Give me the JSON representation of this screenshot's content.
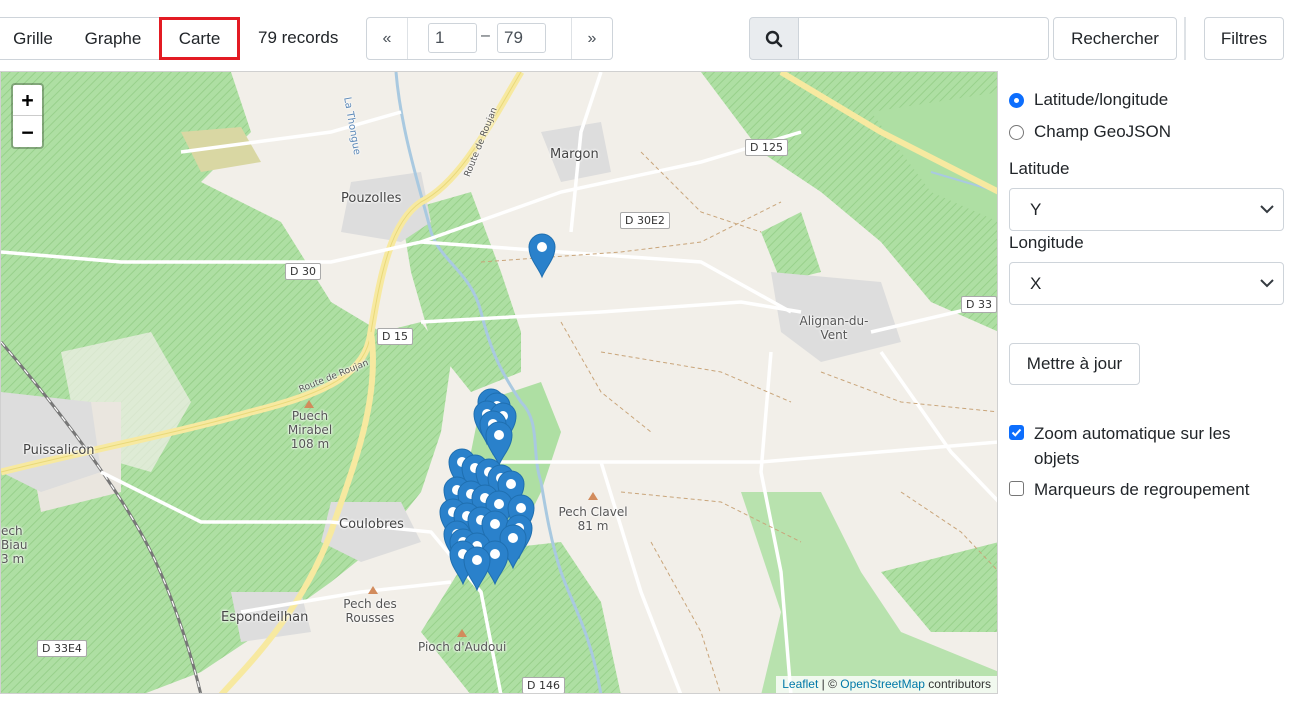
{
  "toolbar": {
    "view_tabs": [
      "Grille",
      "Graphe",
      "Carte"
    ],
    "active_tab": "Carte",
    "records_label": "79 records",
    "pager": {
      "prev": "«",
      "start": "1",
      "separator": "–",
      "end": "79",
      "next": "»"
    },
    "search_value": "",
    "search_button": "Rechercher",
    "filters_button": "Filtres"
  },
  "map": {
    "zoom_in": "+",
    "zoom_out": "−",
    "places": {
      "margon": "Margon",
      "pouzolles": "Pouzolles",
      "alignan_1": "Alignan-du-",
      "alignan_2": "Vent",
      "puissalicon": "Puissalicon",
      "coulobres": "Coulobres",
      "espondeilhan": "Espondeilhan",
      "puech_mirabel_1": "Puech",
      "puech_mirabel_2": "Mirabel",
      "puech_mirabel_3": "108 m",
      "pech_clavel_1": "Pech Clavel",
      "pech_clavel_2": "81 m",
      "pech_rousses_1": "Pech des",
      "pech_rousses_2": "Rousses",
      "pioch_audoui": "Pioch d'Audoui",
      "pech_left_1": "ech",
      "pech_left_2": "Biau",
      "pech_left_3": "3 m",
      "thongue": "La Thongue",
      "route_roujan_1": "Route de Roujan",
      "route_roujan_2": "Route de Roujan"
    },
    "roads": {
      "d125": "D 125",
      "d30e2": "D 30E2",
      "d30": "D 30",
      "d33": "D 33",
      "d15": "D 15",
      "d33e4": "D 33E4",
      "d146": "D 146"
    },
    "attribution": {
      "leaflet": "Leaflet",
      "sep": " | © ",
      "osm": "OpenStreetMap",
      "suffix": " contributors"
    },
    "marker_color": "#2a81cb"
  },
  "panel": {
    "coord_mode_options": [
      "Latitude/longitude",
      "Champ GeoJSON"
    ],
    "coord_mode_selected": "Latitude/longitude",
    "latitude_label": "Latitude",
    "latitude_value": "Y",
    "longitude_label": "Longitude",
    "longitude_value": "X",
    "update_button": "Mettre à jour",
    "auto_zoom_label_1": "Zoom automatique sur les",
    "auto_zoom_label_2": "objets",
    "auto_zoom_checked": true,
    "cluster_label": "Marqueurs de regroupement",
    "cluster_checked": false
  }
}
